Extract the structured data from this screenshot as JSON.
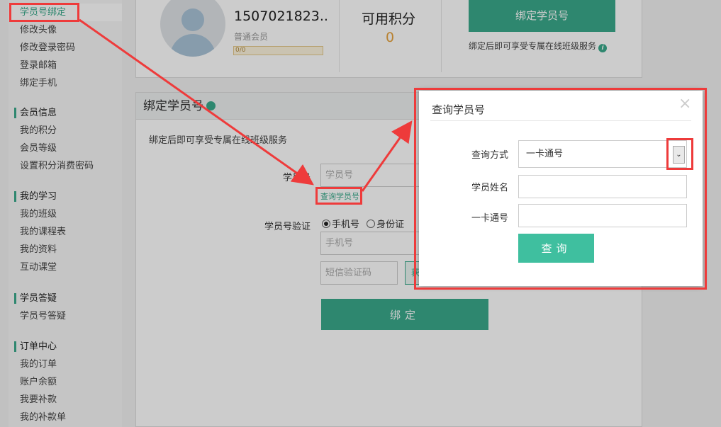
{
  "sidebar": {
    "account_items": [
      "学员号绑定",
      "修改头像",
      "修改登录密码",
      "登录邮箱",
      "绑定手机"
    ],
    "groups": [
      {
        "title": "会员信息",
        "items": [
          "我的积分",
          "会员等级",
          "设置积分消费密码"
        ]
      },
      {
        "title": "我的学习",
        "items": [
          "我的班级",
          "我的课程表",
          "我的资料",
          "互动课堂"
        ]
      },
      {
        "title": "学员答疑",
        "items": [
          "学员号答疑"
        ]
      },
      {
        "title": "订单中心",
        "items": [
          "我的订单",
          "账户余额",
          "我要补款",
          "我的补款单"
        ]
      }
    ]
  },
  "profile": {
    "phone": "1507021823..",
    "level": "普通会员",
    "level_progress": "0/0",
    "points_title": "可用积分",
    "points_value": "0",
    "bind_button": "绑定学员号",
    "bind_tip": "绑定后即可享受专属在线班级服务"
  },
  "panel": {
    "title": "绑定学员号",
    "tip": "绑定后即可享受专属在线班级服务",
    "student_no_label": "学员号",
    "student_no_placeholder": "学员号",
    "query_link": "查询学员号",
    "verify_label": "学员号验证",
    "radio_phone": "手机号",
    "radio_id": "身份证",
    "phone_placeholder": "手机号",
    "sms_placeholder": "短信验证码",
    "sms_button": "获",
    "bind_button": "绑定"
  },
  "modal": {
    "title": "查询学员号",
    "close_icon": "×",
    "method_label": "查询方式",
    "method_value": "一卡通号",
    "caret": "⌄",
    "name_label": "学员姓名",
    "card_label": "一卡通号",
    "query_button": "查询"
  },
  "colors": {
    "accent": "#3aa98b",
    "annotation": "#ee3b3b",
    "points": "#e6a23c"
  }
}
